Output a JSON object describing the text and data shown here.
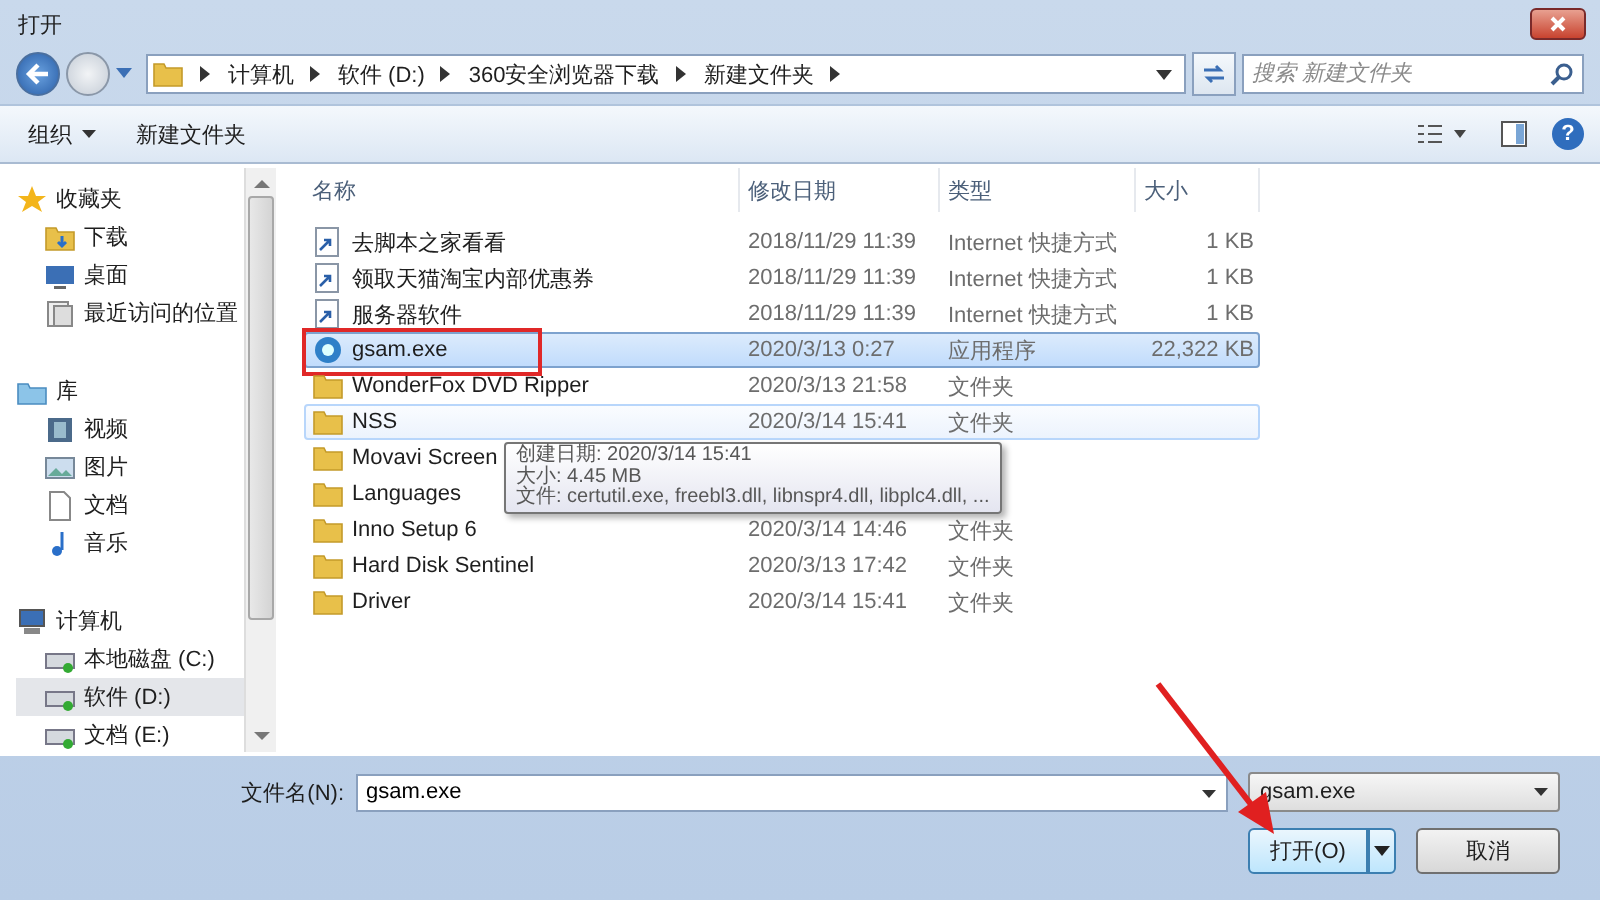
{
  "window": {
    "title": "打开"
  },
  "address": {
    "breadcrumbs": [
      "计算机",
      "软件 (D:)",
      "360安全浏览器下载",
      "新建文件夹"
    ],
    "search": {
      "placeholder": "搜索 新建文件夹"
    }
  },
  "toolbar": {
    "organize": "组织",
    "new_folder": "新建文件夹",
    "help": "?"
  },
  "sidebar": {
    "groups": [
      {
        "label": "收藏夹",
        "kind": "star",
        "children": [
          {
            "label": "下载",
            "kind": "download",
            "selected": false
          },
          {
            "label": "桌面",
            "kind": "desktop",
            "selected": false
          },
          {
            "label": "最近访问的位置",
            "kind": "recent",
            "selected": false
          }
        ]
      },
      {
        "label": "库",
        "kind": "library",
        "children": [
          {
            "label": "视频",
            "kind": "video",
            "selected": false
          },
          {
            "label": "图片",
            "kind": "picture",
            "selected": false
          },
          {
            "label": "文档",
            "kind": "document",
            "selected": false
          },
          {
            "label": "音乐",
            "kind": "music",
            "selected": false
          }
        ]
      },
      {
        "label": "计算机",
        "kind": "computer",
        "children": [
          {
            "label": "本地磁盘 (C:)",
            "kind": "drive",
            "selected": false
          },
          {
            "label": "软件 (D:)",
            "kind": "drive",
            "selected": true
          },
          {
            "label": "文档 (E:)",
            "kind": "drive",
            "selected": false
          }
        ]
      }
    ]
  },
  "file_list": {
    "columns": [
      "名称",
      "修改日期",
      "类型",
      "大小"
    ],
    "rows": [
      {
        "kind": "shortcut",
        "name": "去脚本之家看看",
        "modified": "2018/11/29 11:39",
        "type": "Internet 快捷方式",
        "size": "1 KB",
        "selected": false,
        "hovered": false
      },
      {
        "kind": "shortcut",
        "name": "领取天猫淘宝内部优惠券",
        "modified": "2018/11/29 11:39",
        "type": "Internet 快捷方式",
        "size": "1 KB",
        "selected": false,
        "hovered": false
      },
      {
        "kind": "shortcut",
        "name": "服务器软件",
        "modified": "2018/11/29 11:39",
        "type": "Internet 快捷方式",
        "size": "1 KB",
        "selected": false,
        "hovered": false
      },
      {
        "kind": "app",
        "name": "gsam.exe",
        "modified": "2020/3/13 0:27",
        "type": "应用程序",
        "size": "22,322 KB",
        "selected": true,
        "hovered": false
      },
      {
        "kind": "folder",
        "name": "WonderFox DVD Ripper",
        "modified": "2020/3/13 21:58",
        "type": "文件夹",
        "selected": false,
        "hovered": false
      },
      {
        "kind": "folder",
        "name": "NSS",
        "modified": "2020/3/14 15:41",
        "type": "文件夹",
        "selected": false,
        "hovered": true
      },
      {
        "kind": "folder",
        "name": "Movavi Screen",
        "selected": false,
        "hovered": false
      },
      {
        "kind": "folder",
        "name": "Languages",
        "selected": false,
        "hovered": false
      },
      {
        "kind": "folder",
        "name": "Inno Setup 6",
        "modified": "2020/3/14 14:46",
        "type": "文件夹",
        "selected": false,
        "hovered": false
      },
      {
        "kind": "folder",
        "name": "Hard Disk Sentinel",
        "modified": "2020/3/13 17:42",
        "type": "文件夹",
        "selected": false,
        "hovered": false
      },
      {
        "kind": "folder",
        "name": "Driver",
        "modified": "2020/3/14 15:41",
        "type": "文件夹",
        "selected": false,
        "hovered": false
      }
    ]
  },
  "tooltip": {
    "lines": [
      "创建日期: 2020/3/14 15:41",
      "大小: 4.45 MB",
      "文件: certutil.exe, freebl3.dll, libnspr4.dll, libplc4.dll, ..."
    ]
  },
  "footer": {
    "filename_label": "文件名(N):",
    "filename_value": "gsam.exe",
    "filter_value": "gsam.exe",
    "open_button": "打开(O)",
    "cancel_button": "取消"
  }
}
